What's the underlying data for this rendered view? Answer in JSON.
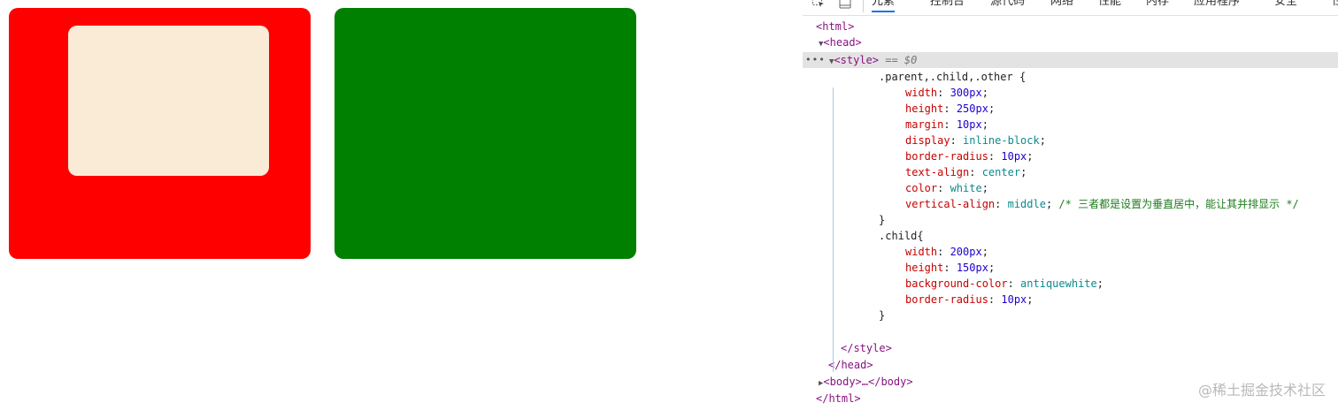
{
  "preview": {
    "colors": {
      "parent": "#ff0000",
      "child": "#faebd7",
      "other": "#008000"
    }
  },
  "devtools": {
    "tabs": [
      "元素",
      "控制台",
      "源代码",
      "网络",
      "性能",
      "内存",
      "应用程序",
      "安全",
      "性"
    ],
    "active_tab": "元素",
    "dom": {
      "html_open": "<html>",
      "head_open": "<head>",
      "style_open": "<style>",
      "style_ref": "== $0",
      "dots": "•••",
      "style_close": "</style>",
      "head_close": "</head>",
      "body_collapsed": "<body>…</body>",
      "html_close": "</html>"
    },
    "css": {
      "rule1_selector": ".parent,.child,.other {",
      "rule1": [
        {
          "prop": "width",
          "value": "300px"
        },
        {
          "prop": "height",
          "value": "250px"
        },
        {
          "prop": "margin",
          "value": "10px"
        },
        {
          "prop": "display",
          "value": "inline-block"
        },
        {
          "prop": "border-radius",
          "value": "10px"
        },
        {
          "prop": "text-align",
          "value": "center"
        },
        {
          "prop": "color",
          "value": "white"
        },
        {
          "prop": "vertical-align",
          "value": "middle",
          "comment": "/* 三者都是设置为垂直居中，能让其并排显示 */"
        }
      ],
      "close_brace": "}",
      "rule2_selector": ".child{",
      "rule2": [
        {
          "prop": "width",
          "value": "200px"
        },
        {
          "prop": "height",
          "value": "150px"
        },
        {
          "prop": "background-color",
          "value": "antiquewhite"
        },
        {
          "prop": "border-radius",
          "value": "10px"
        }
      ]
    }
  },
  "watermark": "@稀土掘金技术社区"
}
